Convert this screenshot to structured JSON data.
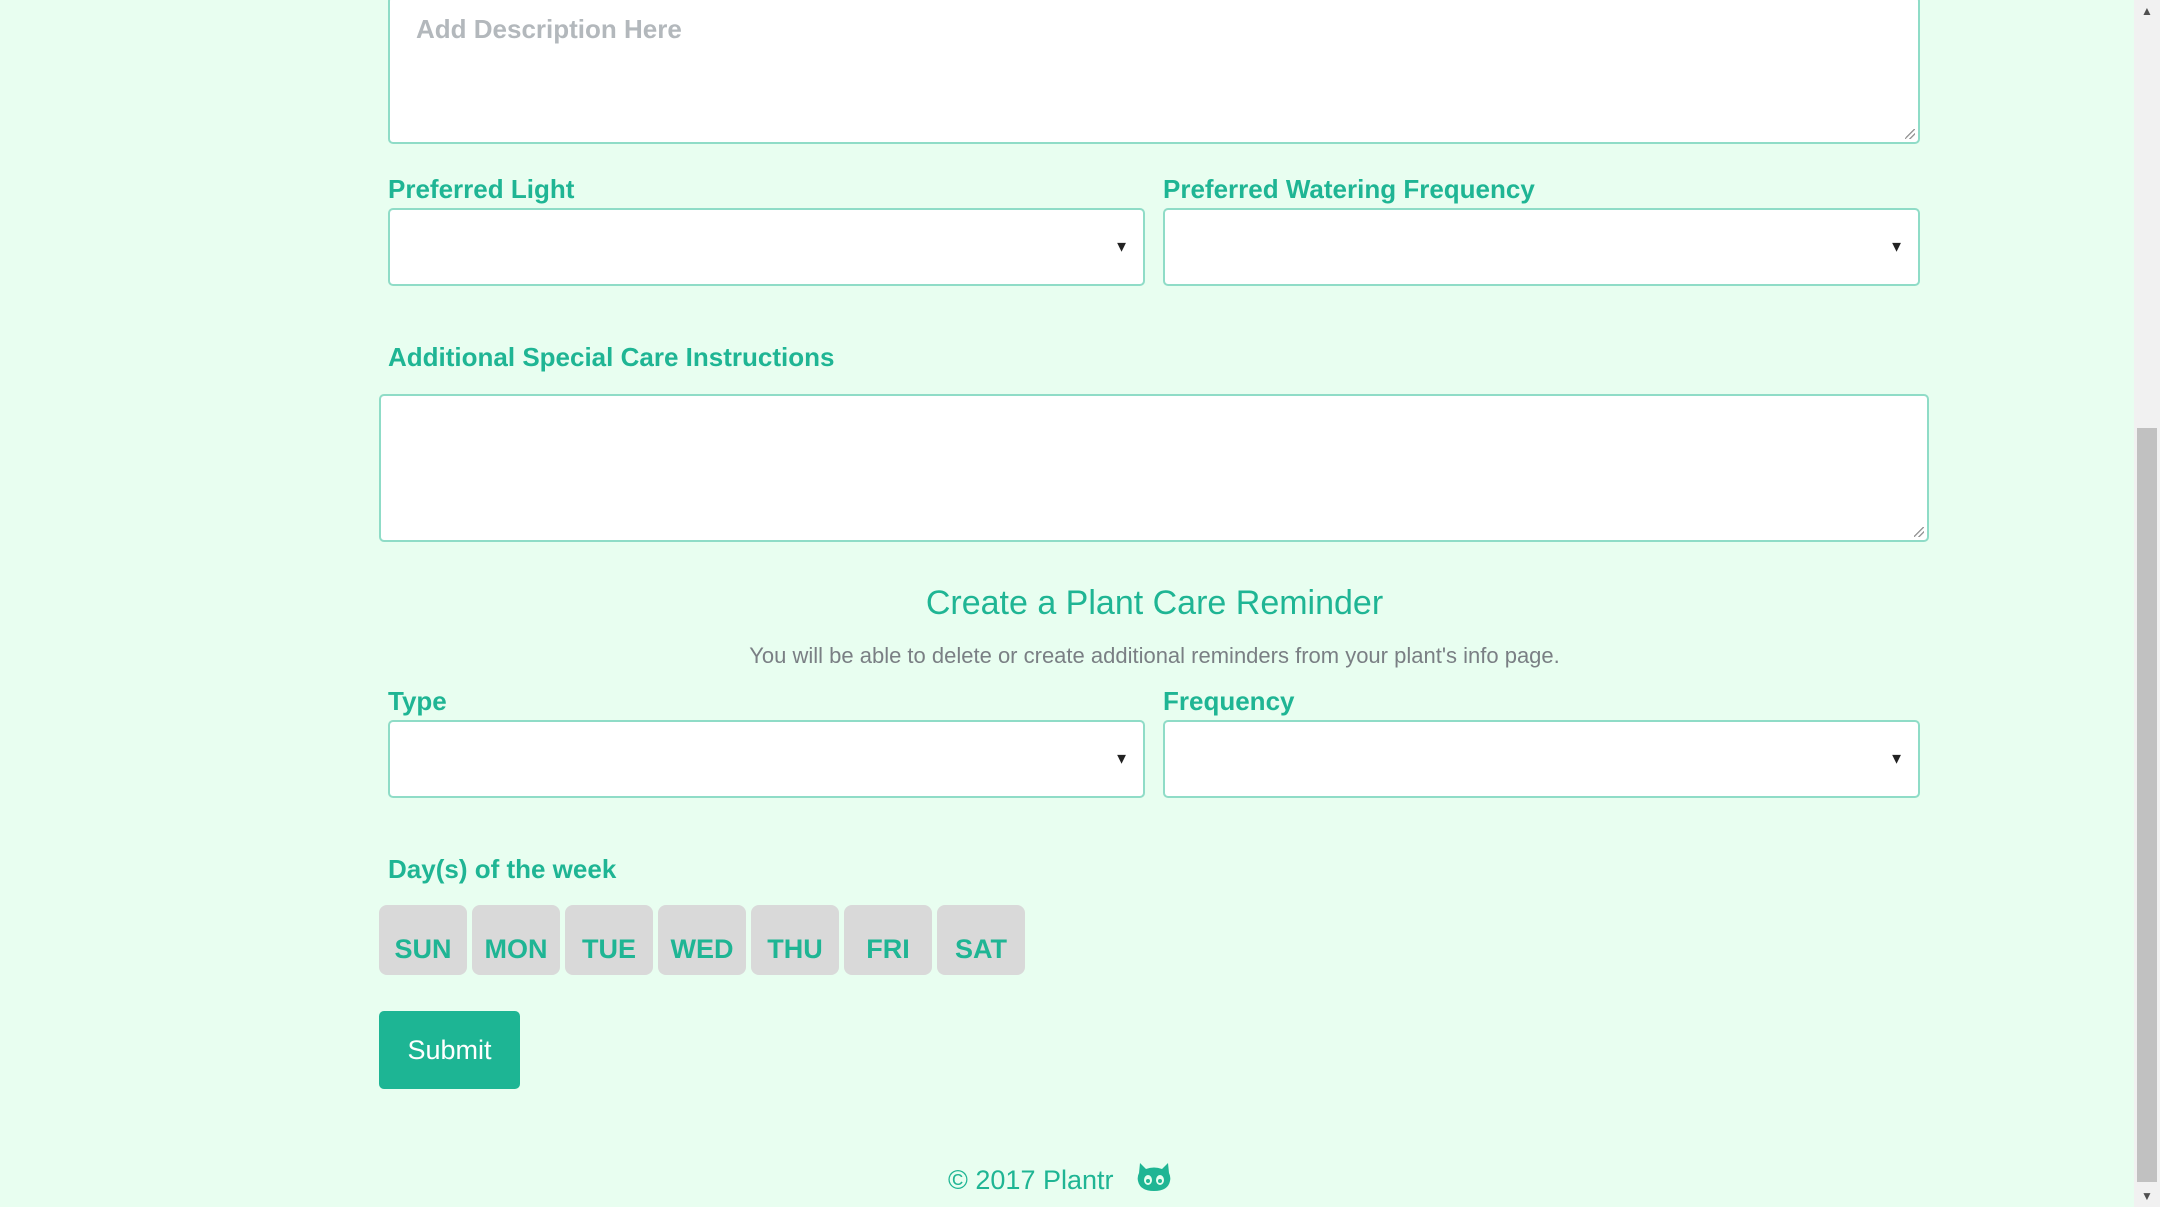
{
  "form": {
    "description_placeholder": "Add Description Here",
    "preferred_light_label": "Preferred Light",
    "preferred_light_value": "",
    "preferred_watering_label": "Preferred Watering Frequency",
    "preferred_watering_value": "",
    "special_care_label": "Additional Special Care Instructions",
    "special_care_value": ""
  },
  "reminder": {
    "title": "Create a Plant Care Reminder",
    "subtitle": "You will be able to delete or create additional reminders from your plant's info page.",
    "type_label": "Type",
    "type_value": "",
    "frequency_label": "Frequency",
    "frequency_value": "",
    "days_label": "Day(s) of the week",
    "days": [
      "SUN",
      "MON",
      "TUE",
      "WED",
      "THU",
      "FRI",
      "SAT"
    ]
  },
  "submit_label": "Submit",
  "footer": {
    "copyright": "© 2017 Plantr",
    "github_icon": "github-icon"
  },
  "colors": {
    "background": "#e8fef0",
    "accent": "#1fb594",
    "day_button_bg": "#d9d9d9"
  }
}
